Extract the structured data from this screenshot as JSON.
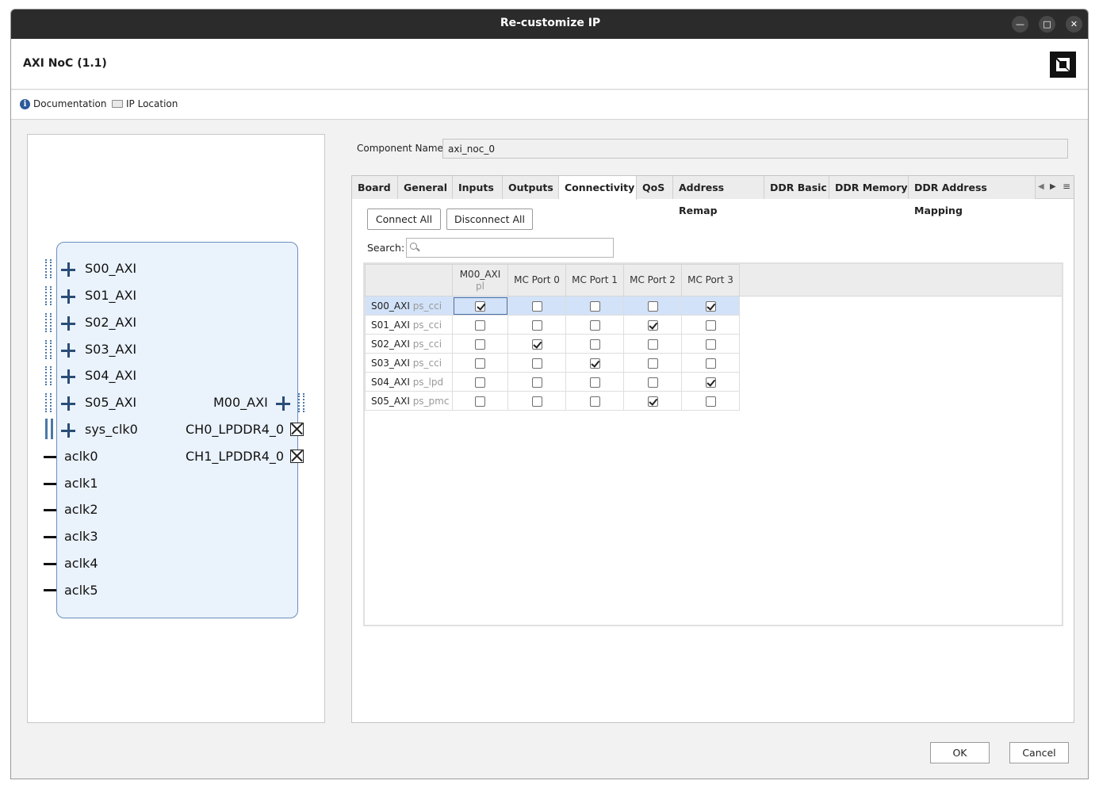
{
  "window": {
    "title": "Re-customize IP"
  },
  "header": {
    "ip_name": "AXI NoC (1.1)"
  },
  "toolbar": {
    "documentation": "Documentation",
    "ip_location": "IP Location"
  },
  "symbol": {
    "left_ports": [
      "S00_AXI",
      "S01_AXI",
      "S02_AXI",
      "S03_AXI",
      "S04_AXI",
      "S05_AXI",
      "sys_clk0"
    ],
    "clk_ports": [
      "aclk0",
      "aclk1",
      "aclk2",
      "aclk3",
      "aclk4",
      "aclk5"
    ],
    "right_ports": [
      "M00_AXI",
      "CH0_LPDDR4_0",
      "CH1_LPDDR4_0"
    ]
  },
  "component": {
    "label": "Component Name",
    "value": "axi_noc_0"
  },
  "tabs": [
    "Board",
    "General",
    "Inputs",
    "Outputs",
    "Connectivity",
    "QoS",
    "Address Remap",
    "DDR Basic",
    "DDR Memory",
    "DDR Address Mapping"
  ],
  "active_tab": "Connectivity",
  "connectivity": {
    "connect_all": "Connect All",
    "disconnect_all": "Disconnect All",
    "search_label": "Search:",
    "columns": [
      {
        "name": "M00_AXI",
        "sub": "pl"
      },
      {
        "name": "MC Port 0",
        "sub": ""
      },
      {
        "name": "MC Port 1",
        "sub": ""
      },
      {
        "name": "MC Port 2",
        "sub": ""
      },
      {
        "name": "MC Port 3",
        "sub": ""
      }
    ],
    "rows": [
      {
        "name": "S00_AXI",
        "iface": "ps_cci",
        "checks": [
          true,
          false,
          false,
          false,
          true
        ]
      },
      {
        "name": "S01_AXI",
        "iface": "ps_cci",
        "checks": [
          false,
          false,
          false,
          true,
          false
        ]
      },
      {
        "name": "S02_AXI",
        "iface": "ps_cci",
        "checks": [
          false,
          true,
          false,
          false,
          false
        ]
      },
      {
        "name": "S03_AXI",
        "iface": "ps_cci",
        "checks": [
          false,
          false,
          true,
          false,
          false
        ]
      },
      {
        "name": "S04_AXI",
        "iface": "ps_lpd",
        "checks": [
          false,
          false,
          false,
          false,
          true
        ]
      },
      {
        "name": "S05_AXI",
        "iface": "ps_pmc",
        "checks": [
          false,
          false,
          false,
          true,
          false
        ]
      }
    ]
  },
  "footer": {
    "ok": "OK",
    "cancel": "Cancel"
  }
}
